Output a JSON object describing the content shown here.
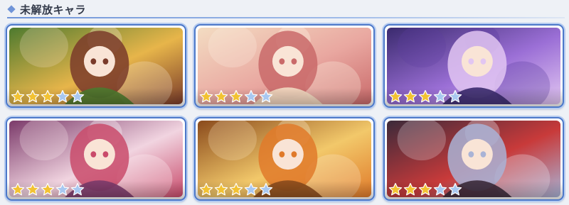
{
  "section": {
    "title": "未解放キャラ",
    "accent_color": "#6f94d8"
  },
  "star_colors": {
    "filled": "#f2c233",
    "empty": "#a9c8f0"
  },
  "cards": [
    {
      "stars_filled": 3,
      "stars_total": 5,
      "palette": [
        "#4d7a2f",
        "#e7b54a",
        "#7a3b2a",
        "#f4e0c8"
      ]
    },
    {
      "stars_filled": 3,
      "stars_total": 5,
      "palette": [
        "#f3dcc2",
        "#e9a7a0",
        "#c96a6a",
        "#fff4e6"
      ]
    },
    {
      "stars_filled": 3,
      "stars_total": 5,
      "palette": [
        "#3a2a6e",
        "#9b6fd6",
        "#e2c6f2",
        "#5b3da0"
      ]
    },
    {
      "stars_filled": 3,
      "stars_total": 5,
      "palette": [
        "#7b3a6a",
        "#f1d4e0",
        "#c94b6b",
        "#fff3f5"
      ]
    },
    {
      "stars_filled": 3,
      "stars_total": 5,
      "palette": [
        "#8a4a1c",
        "#f2c86a",
        "#e07a2a",
        "#fbe6c4"
      ]
    },
    {
      "stars_filled": 3,
      "stars_total": 5,
      "palette": [
        "#3b2a3a",
        "#c83a3a",
        "#a9b3d6",
        "#f0e6ee"
      ]
    }
  ]
}
